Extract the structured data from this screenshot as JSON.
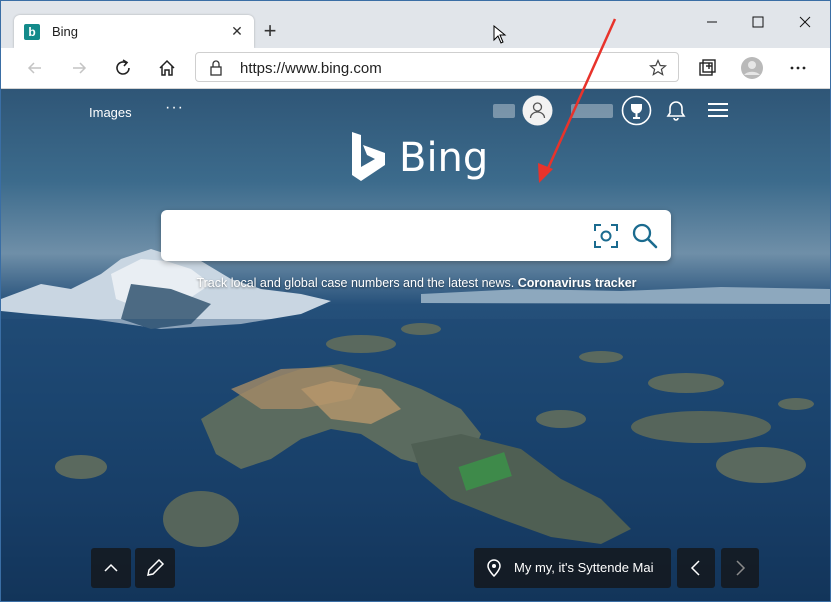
{
  "tab": {
    "title": "Bing",
    "favicon_icon": "bing-b-icon",
    "close_label": "✕"
  },
  "new_tab_label": "+",
  "window_controls": {
    "minimize": "—",
    "maximize": "☐",
    "close": "✕"
  },
  "address_bar": {
    "url": "https://www.bing.com"
  },
  "top_nav": {
    "images_label": "Images",
    "more_label": "···"
  },
  "brand": {
    "name": "Bing"
  },
  "search": {
    "placeholder": ""
  },
  "promo": {
    "text": "Track local and global case numbers and the latest news. ",
    "link": "Coronavirus tracker"
  },
  "bottom": {
    "caption": "My my, it's Syttende Mai"
  },
  "colors": {
    "accent": "#138a8a",
    "annotation_arrow": "#e8332b"
  }
}
